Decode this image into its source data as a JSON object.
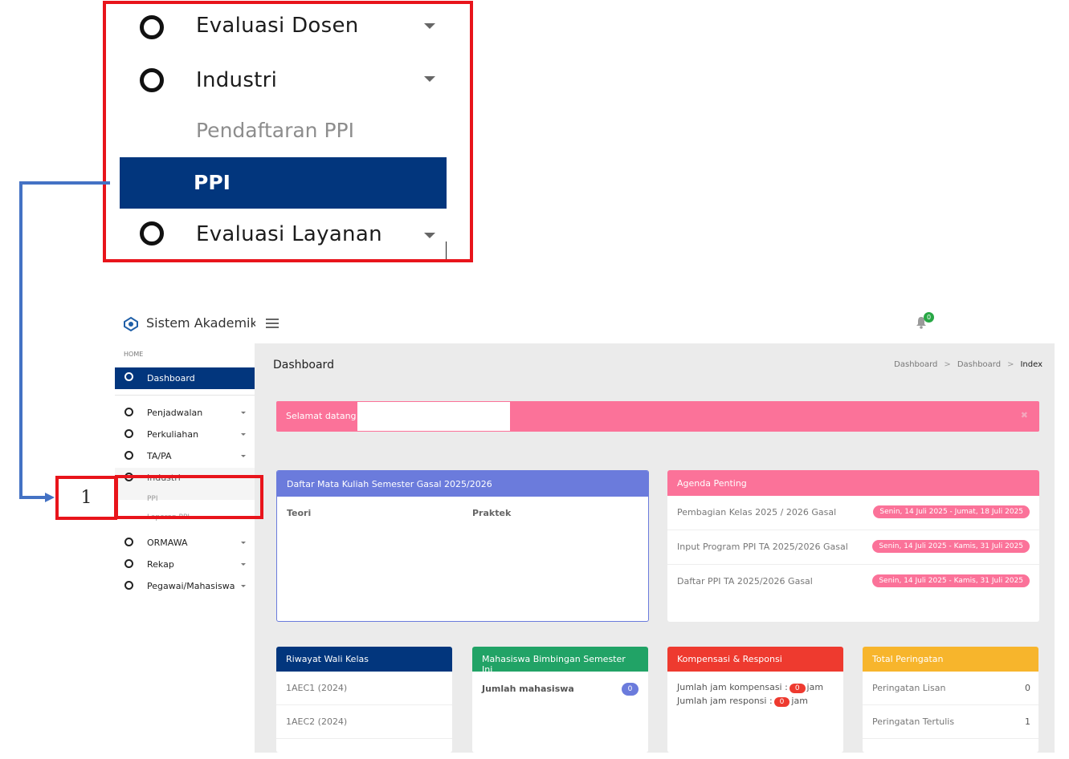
{
  "callout": {
    "items": [
      {
        "label": "Evaluasi Dosen"
      },
      {
        "label": "Industri"
      },
      {
        "label": "Pendaftaran PPI"
      },
      {
        "label": "PPI"
      },
      {
        "label": "Evaluasi Layanan"
      }
    ],
    "step_number": "1"
  },
  "app": {
    "title": "Sistem Akademik",
    "notification_count": "0"
  },
  "sidebar": {
    "section_label": "HOME",
    "dashboard": "Dashboard",
    "items": [
      {
        "label": "Penjadwalan"
      },
      {
        "label": "Perkuliahan"
      },
      {
        "label": "TA/PA"
      },
      {
        "label": "Industri"
      },
      {
        "label": "PPI"
      },
      {
        "label": "Laporan PPI"
      },
      {
        "label": "ORMAWA"
      },
      {
        "label": "Rekap"
      },
      {
        "label": "Pegawai/Mahasiswa"
      }
    ]
  },
  "main": {
    "page_title": "Dashboard",
    "breadcrumb": [
      "Dashboard",
      "Dashboard",
      "Index"
    ],
    "breadcrumb_sep": ">",
    "welcome": "Selamat datang",
    "welcome_close": "✖"
  },
  "cards": {
    "mata_kuliah": {
      "title": "Daftar Mata Kuliah Semester Gasal 2025/2026",
      "col_teori": "Teori",
      "col_praktek": "Praktek"
    },
    "agenda": {
      "title": "Agenda Penting",
      "rows": [
        {
          "label": "Pembagian Kelas 2025 / 2026 Gasal",
          "date": "Senin, 14 Juli 2025 - Jumat, 18 Juli 2025"
        },
        {
          "label": "Input Program PPI TA 2025/2026 Gasal",
          "date": "Senin, 14 Juli 2025 - Kamis, 31 Juli 2025"
        },
        {
          "label": "Daftar PPI TA 2025/2026 Gasal",
          "date": "Senin, 14 Juli 2025 - Kamis, 31 Juli 2025"
        }
      ]
    },
    "wali": {
      "title": "Riwayat Wali Kelas",
      "rows": [
        "1AEC1 (2024)",
        "1AEC2 (2024)"
      ]
    },
    "bimbingan": {
      "title": "Mahasiswa Bimbingan Semester Ini",
      "label": "Jumlah mahasiswa",
      "count": "0"
    },
    "kompensasi": {
      "title": "Kompensasi & Responsi",
      "line1_prefix": "Jumlah jam kompensasi :",
      "line1_value": "0",
      "line2_prefix": "Jumlah jam responsi :",
      "line2_value": "0",
      "unit": "jam"
    },
    "peringatan": {
      "title": "Total Peringatan",
      "rows": [
        {
          "label": "Peringatan Lisan",
          "value": "0"
        },
        {
          "label": "Peringatan Tertulis",
          "value": "1"
        }
      ]
    }
  },
  "colors": {
    "navy": "#02367d",
    "pink": "#fb7299",
    "indigo": "#6b7bdc",
    "green": "#21a366",
    "red": "#ee3a2f",
    "amber": "#f7b52c",
    "callout_red": "#e8141b",
    "connector_blue": "#4472c4"
  }
}
